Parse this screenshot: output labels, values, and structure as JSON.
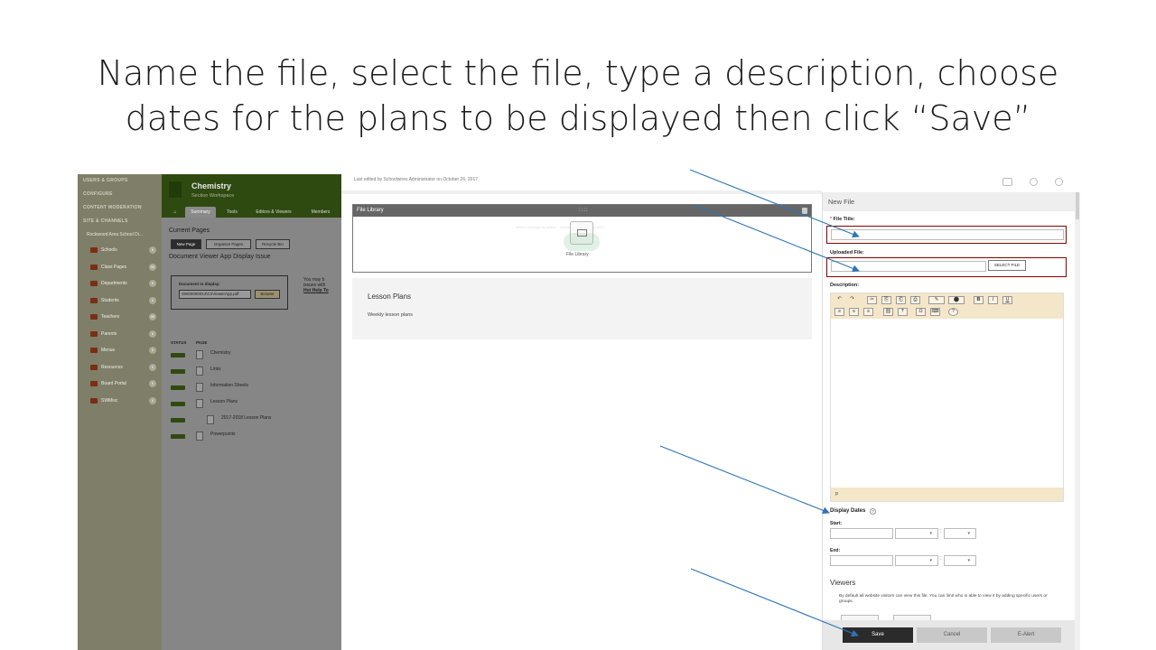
{
  "slide": {
    "title_line1": "Name the file, select the file, type a description, choose",
    "title_line2": "dates for the plans to be displayed then click “Save”"
  },
  "cms": {
    "sidebar_sections": [
      "USERS & GROUPS",
      "CONFIGURE",
      "CONTENT MODERATION",
      "SITE & CHANNELS"
    ],
    "school": "Rockwood Area School Di...",
    "items": [
      {
        "label": "Schools",
        "count": "0"
      },
      {
        "label": "Class Pages",
        "count": "00"
      },
      {
        "label": "Departments",
        "count": "0"
      },
      {
        "label": "Students",
        "count": "0"
      },
      {
        "label": "Teachers",
        "count": "00"
      },
      {
        "label": "Parents",
        "count": "0"
      },
      {
        "label": "Menus",
        "count": "0"
      },
      {
        "label": "Resources",
        "count": "0"
      },
      {
        "label": "Board Portal",
        "count": "0"
      },
      {
        "label": "SWMisc",
        "count": "0"
      }
    ],
    "workspace_title": "Chemistry",
    "workspace_sub": "Section Workspace",
    "tabs": [
      "⌂",
      "Summary",
      "Tools",
      "Editors & Viewers",
      "Members"
    ],
    "current_pages": "Current Pages",
    "btn_new": "New Page",
    "btn_organize": "Organize Pages",
    "btn_recycle": "Recycle Bin",
    "issue_title": "Document Viewer App Display Issue",
    "doc_label": "Document to display:",
    "doc_value": "SW00000014\\C2ViewerApp.pdf",
    "doc_browse": "Browse",
    "side_note_1": "You may b",
    "side_note_2": "issues with",
    "side_note_3": "Hot Help To",
    "col_status": "STATUS",
    "col_page": "PAGE",
    "pages": [
      "Chemistry",
      "Links",
      "Information Sheets",
      "Lesson Plans",
      "2017-2018 Lesson Plans",
      "Powerpoints"
    ]
  },
  "editor": {
    "last_edited": "Last edited by Schoolwires Administrator on October 26, 2017.",
    "file_library_bar": "File Library",
    "grip": "::::",
    "hint": "Where viewing the active... information will display here.",
    "file_library_label": "File Library",
    "lesson_plans_title": "Lesson Plans",
    "lesson_plans_desc": "Weekly lesson plans"
  },
  "form": {
    "panel_title": "New File",
    "req_mark": "*",
    "file_title_label": "File Title:",
    "uploaded_label": "Uploaded File:",
    "select_file": "SELECT FILE",
    "description_label": "Description:",
    "editor_footer": "p",
    "toolbar_row1": [
      "↶",
      "↷",
      "✂",
      "⎘",
      "⎗",
      "⎙",
      "✎",
      "⬤",
      "B",
      "I",
      "U"
    ],
    "toolbar_row2": [
      "≡",
      "≡",
      "≡",
      "⛓",
      "⤒",
      "Ω",
      "⌨",
      "?"
    ],
    "display_dates": "Display Dates",
    "help": "?",
    "start_label": "Start:",
    "end_label": "End:",
    "dropdown_arrow": "▾",
    "time_colon": ":",
    "viewers_title": "Viewers",
    "viewers_text": "By default all website visitors can view this file. You can limit who is able to view it by adding specific users or groups.",
    "save": "Save",
    "cancel": "Cancel",
    "ealert": "E-Alert"
  },
  "colors": {
    "accent_red": "#8b0000",
    "arrow_blue": "#2e75b6",
    "save_bg": "#2b2b2b",
    "cms_green": "#2f4a10",
    "rte_toolbar": "#f4e6c8"
  }
}
